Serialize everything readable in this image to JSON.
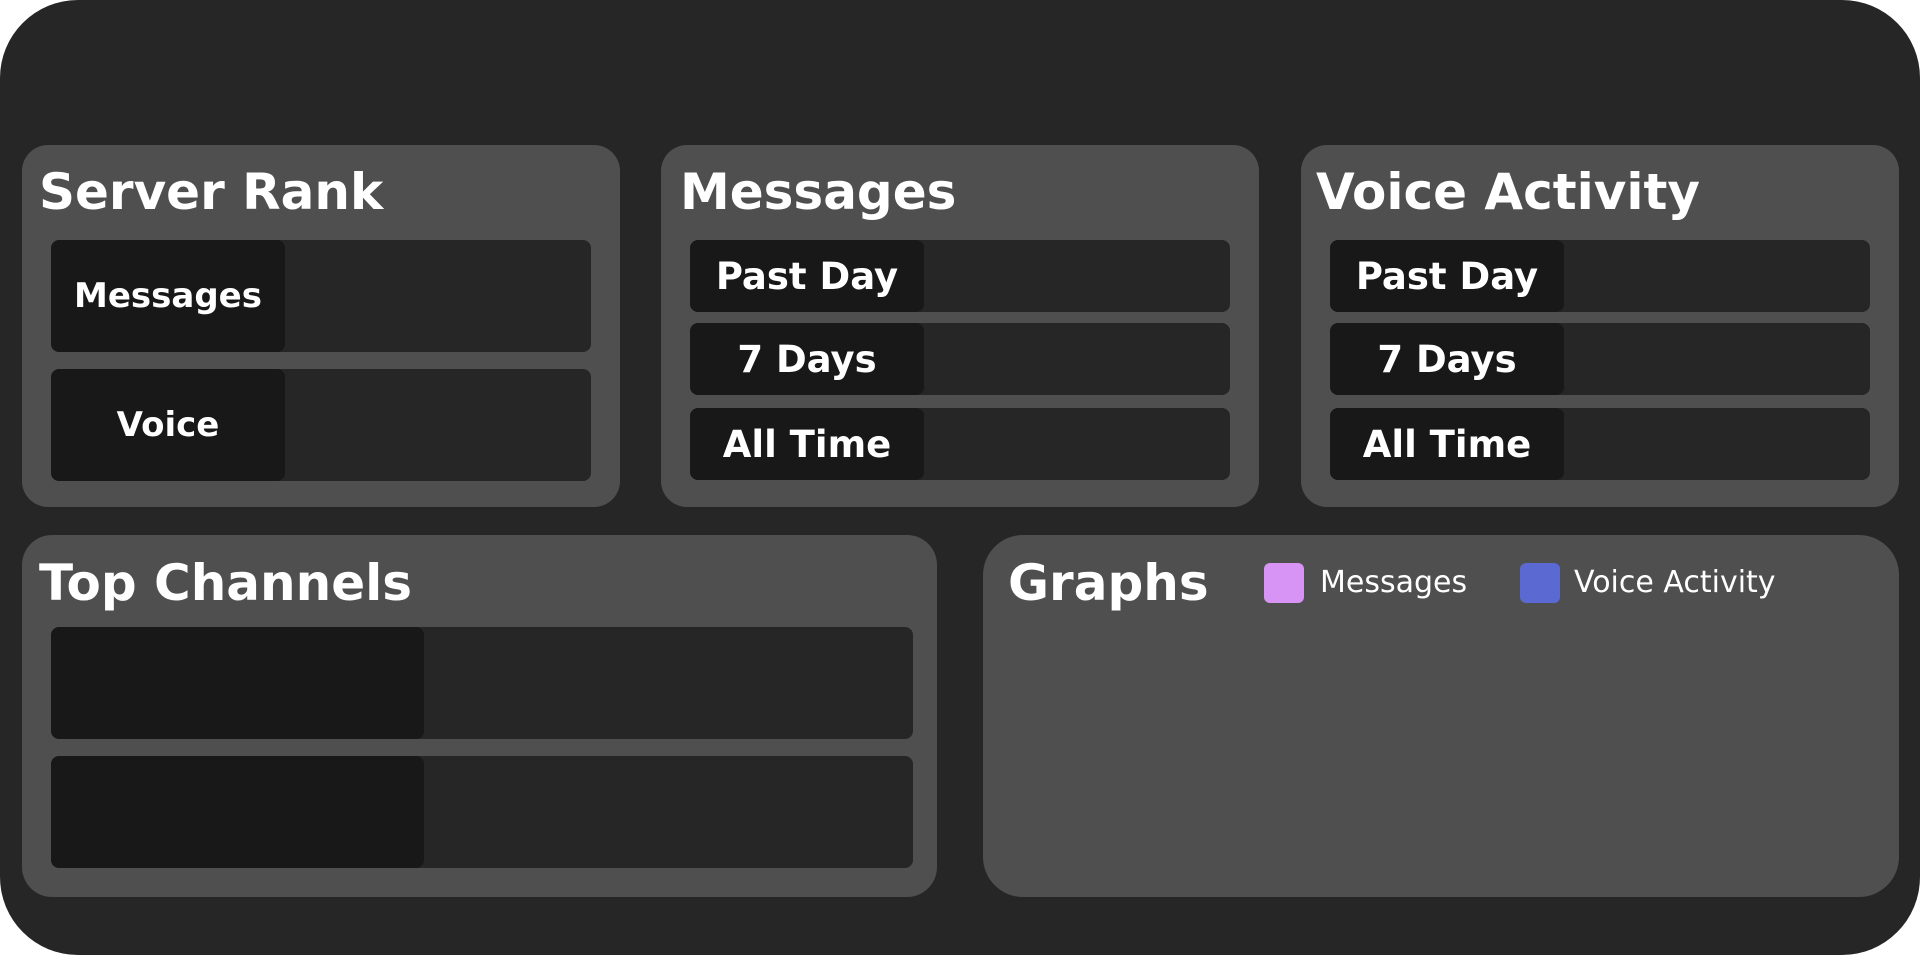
{
  "server_rank": {
    "title": "Server Rank",
    "rows": [
      {
        "label": "Messages",
        "value": ""
      },
      {
        "label": "Voice",
        "value": ""
      }
    ]
  },
  "messages": {
    "title": "Messages",
    "rows": [
      {
        "label": "Past Day",
        "value": ""
      },
      {
        "label": "7 Days",
        "value": ""
      },
      {
        "label": "All Time",
        "value": ""
      }
    ]
  },
  "voice_activity": {
    "title": "Voice Activity",
    "rows": [
      {
        "label": "Past Day",
        "value": ""
      },
      {
        "label": "7 Days",
        "value": ""
      },
      {
        "label": "All Time",
        "value": ""
      }
    ]
  },
  "top_channels": {
    "title": "Top Channels",
    "rows": [
      {
        "label": "",
        "value": ""
      },
      {
        "label": "",
        "value": ""
      }
    ]
  },
  "graphs": {
    "title": "Graphs",
    "legend": [
      {
        "label": "Messages",
        "color": "#d894f4"
      },
      {
        "label": "Voice Activity",
        "color": "#5a6ad2"
      }
    ]
  },
  "colors": {
    "background": "#262626",
    "panel": "#4f4f4f",
    "row": "#262626",
    "row_label": "#181818",
    "text": "#ffffff"
  }
}
